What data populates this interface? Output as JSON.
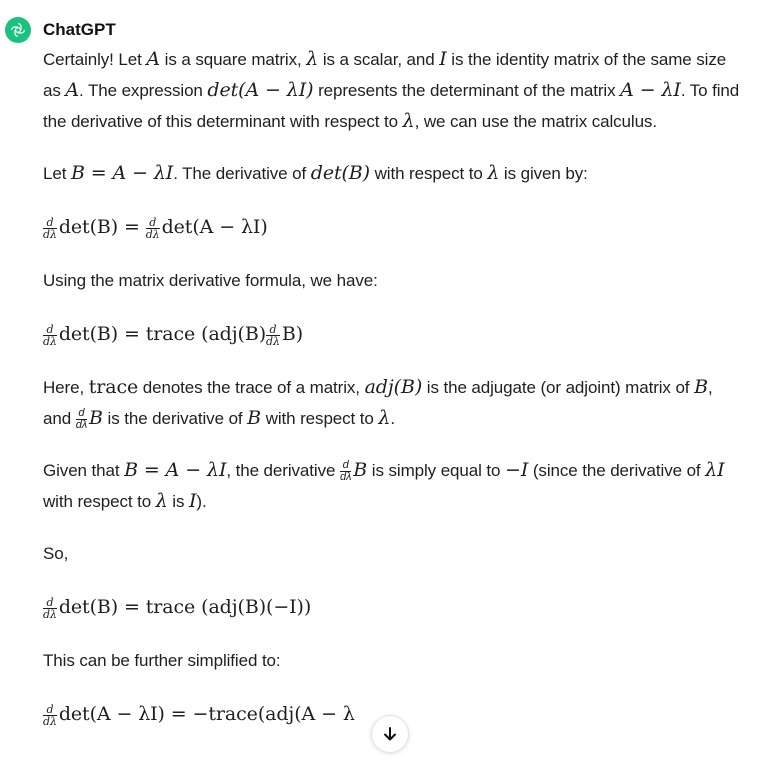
{
  "message": {
    "author": "ChatGPT",
    "avatar_icon": "openai-logo-icon",
    "avatar_color": "#19c37d",
    "p1": {
      "t1": "Certainly! Let ",
      "m1": "A",
      "t2": " is a square matrix, ",
      "m2": "λ",
      "t3": " is a scalar, and ",
      "m3": "I",
      "t4": " is the identity matrix of the same size as ",
      "m4": "A",
      "t5": ". The expression ",
      "m5": "det(A − λI)",
      "t6": " represents the determinant of the matrix ",
      "m6": "A − λI",
      "t7": ". To find the derivative of this determinant with respect to ",
      "m7": "λ",
      "t8": ", we can use the matrix calculus."
    },
    "p2": {
      "t1": "Let ",
      "m1": "B = A − λI",
      "t2": ". The derivative of ",
      "m2": "det(B)",
      "t3": " with respect to ",
      "m3": "λ",
      "t4": " is given by:"
    },
    "eq1": "det(B) = ",
    "eq1b": "det(A − λI)",
    "p3": "Using the matrix derivative formula, we have:",
    "eq2": "det(B) = trace (adj(B)",
    "eq2b": "B)",
    "p4": {
      "m1": "trace",
      "t1": "Here, ",
      "t2": " denotes the trace of a matrix, ",
      "m2": "adj(B)",
      "t3": " is the adjugate (or adjoint) matrix of ",
      "m3": "B",
      "t4": ", and ",
      "m4": "B",
      "t5": " is the derivative of ",
      "m5": "B",
      "t6": " with respect to ",
      "m6": "λ",
      "t7": "."
    },
    "p5": {
      "t1": "Given that ",
      "m1": "B = A − λI",
      "t2": ", the derivative ",
      "m2": "B",
      "t3": " is simply equal to ",
      "m3": "−I",
      "t4": " (since the derivative of ",
      "m4": "λI",
      "t5": " with respect to ",
      "m5": "λ",
      "t6": " is ",
      "m6": "I",
      "t7": ")."
    },
    "p6": "So,",
    "eq3": "det(B) = trace (adj(B)(−I))",
    "p7": "This can be further simplified to:",
    "eq4": "det(A − λI) = −trace(adj(A − λ",
    "frac_num": "d",
    "frac_den": "dλ"
  },
  "scroll_button": {
    "icon": "arrow-down-icon"
  }
}
